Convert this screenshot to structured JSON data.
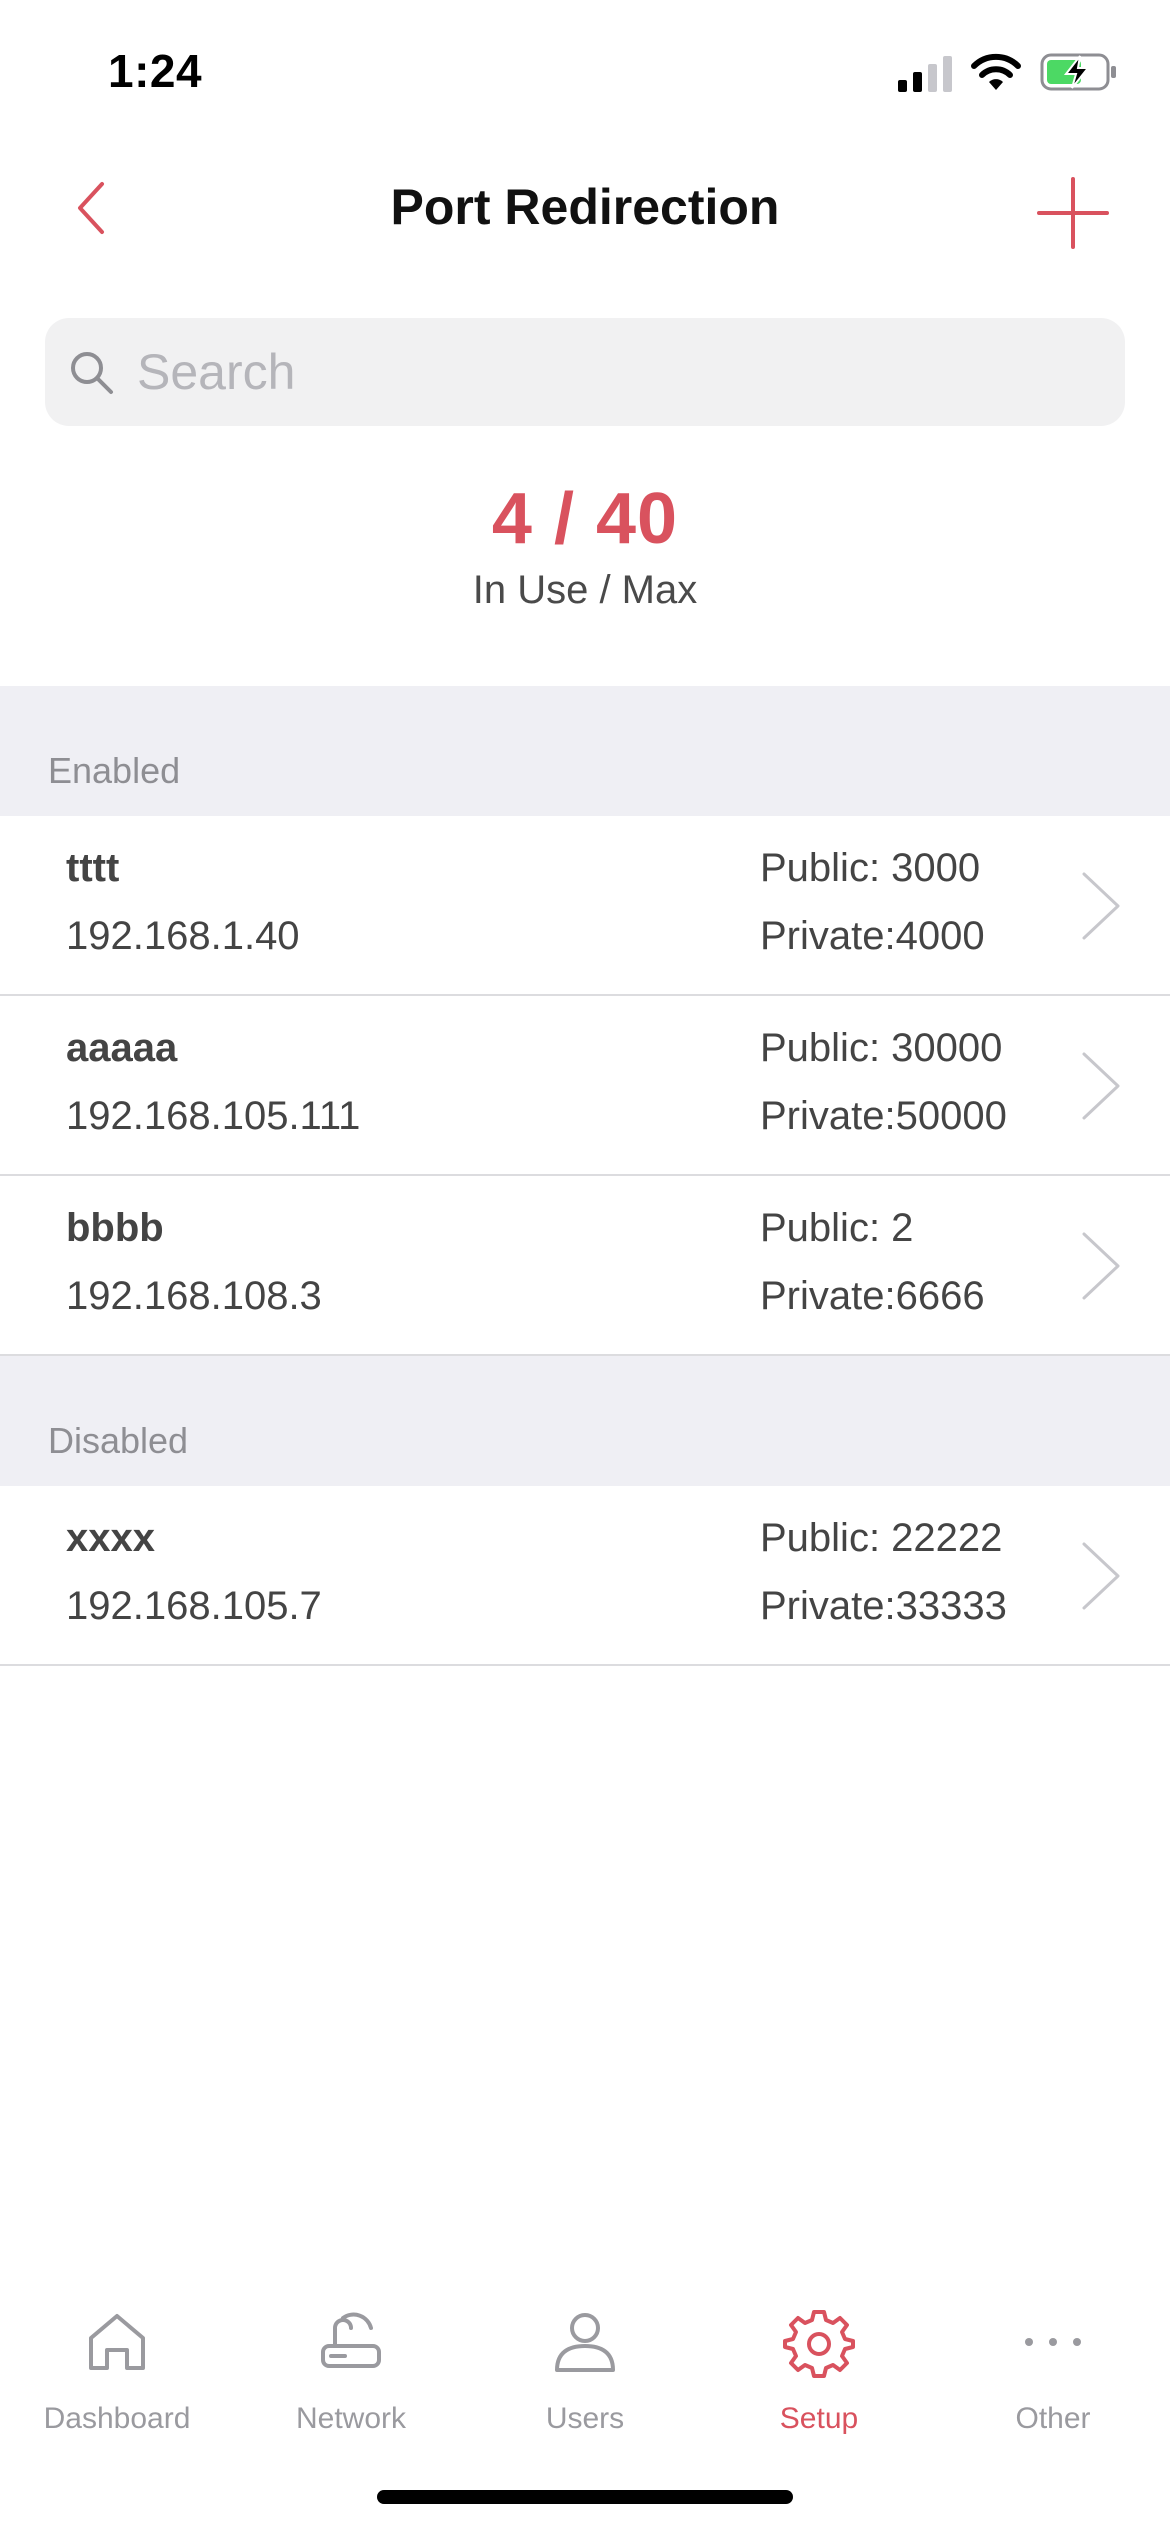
{
  "status_bar": {
    "time": "1:24"
  },
  "header": {
    "title": "Port Redirection"
  },
  "search": {
    "placeholder": "Search"
  },
  "usage": {
    "count": "4 / 40",
    "label": "In Use / Max"
  },
  "sections": {
    "enabled": {
      "label": "Enabled",
      "rows": [
        {
          "name": "tttt",
          "ip": "192.168.1.40",
          "public": "Public: 3000",
          "private": "Private:4000"
        },
        {
          "name": "aaaaa",
          "ip": "192.168.105.111",
          "public": "Public: 30000",
          "private": "Private:50000"
        },
        {
          "name": "bbbb",
          "ip": "192.168.108.3",
          "public": "Public: 2",
          "private": "Private:6666"
        }
      ]
    },
    "disabled": {
      "label": "Disabled",
      "rows": [
        {
          "name": "xxxx",
          "ip": "192.168.105.7",
          "public": "Public: 22222",
          "private": "Private:33333"
        }
      ]
    }
  },
  "tabbar": {
    "tabs": [
      {
        "label": "Dashboard",
        "icon": "home-icon"
      },
      {
        "label": "Network",
        "icon": "router-icon"
      },
      {
        "label": "Users",
        "icon": "user-icon"
      },
      {
        "label": "Setup",
        "icon": "gear-icon",
        "active": true
      },
      {
        "label": "Other",
        "icon": "more-icon"
      }
    ]
  },
  "colors": {
    "accent": "#d9525e",
    "section_bg": "#efeff4",
    "inactive": "#9a9a9f"
  }
}
